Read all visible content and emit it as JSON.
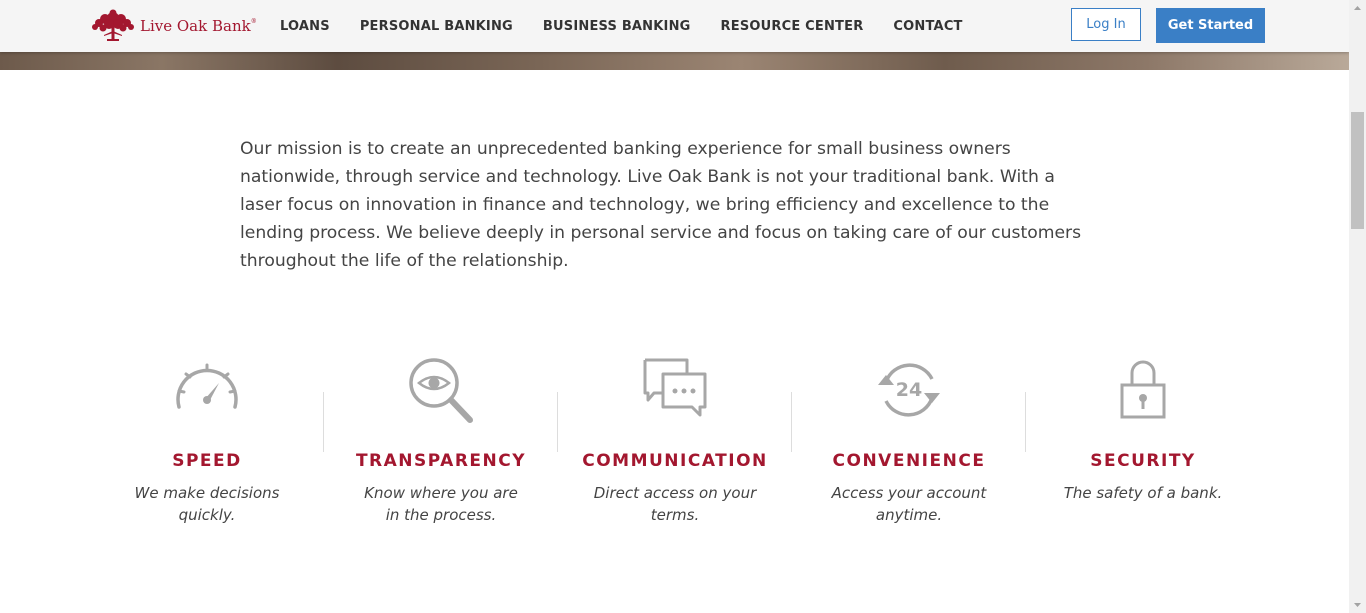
{
  "header": {
    "logo_text": "Live Oak Bank",
    "logo_reg": "®",
    "nav": [
      "LOANS",
      "PERSONAL BANKING",
      "BUSINESS BANKING",
      "RESOURCE CENTER",
      "CONTACT"
    ],
    "login_label": "Log In",
    "get_started_label": "Get Started"
  },
  "mission": {
    "text": "Our mission is to create an unprecedented banking experience for small business owners nationwide, through service and technology. Live Oak Bank is not your traditional bank. With a laser focus on innovation in finance and technology, we bring efficiency and excellence to the lending process. We believe deeply in personal service and focus on taking care of our customers throughout the life of the relationship."
  },
  "features": [
    {
      "title": "SPEED",
      "desc": "We make decisions quickly.",
      "icon": "speedometer-icon"
    },
    {
      "title": "TRANSPARENCY",
      "desc": "Know where you are in the process.",
      "icon": "magnifier-eye-icon"
    },
    {
      "title": "COMMUNICATION",
      "desc": "Direct access on your terms.",
      "icon": "chat-bubbles-icon"
    },
    {
      "title": "CONVENIENCE",
      "desc": "Access your account anytime.",
      "icon": "clock-24-icon"
    },
    {
      "title": "SECURITY",
      "desc": "The safety of a bank.",
      "icon": "padlock-icon"
    }
  ],
  "clock_label": "24",
  "colors": {
    "brand_red": "#a3172f",
    "accent_blue": "#3a7fc6",
    "icon_gray": "#a7a7a7",
    "text": "#444444"
  }
}
